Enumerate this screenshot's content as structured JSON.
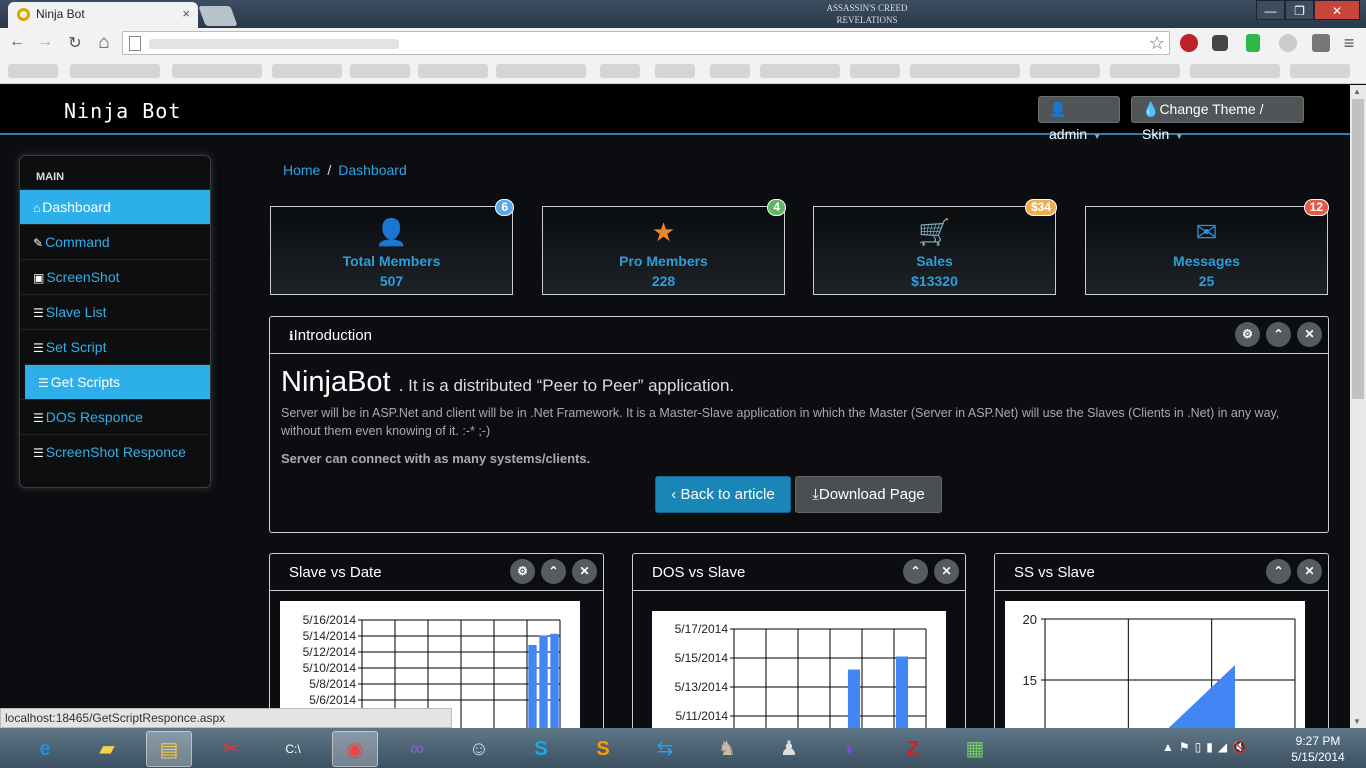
{
  "browser": {
    "tab_title": "Ninja Bot",
    "tab_close": "×",
    "window_controls": [
      "—",
      "❐",
      "✕"
    ],
    "game_logo": "ASSASSIN'S CREED REVELATIONS",
    "nav": {
      "back": "←",
      "forward": "→",
      "reload": "↻",
      "home": "⌂",
      "star": "☆",
      "menu": "≡"
    }
  },
  "app": {
    "brand": "Ninja Bot",
    "user_button": "admin",
    "theme_button": "Change Theme / Skin"
  },
  "sidebar": {
    "heading": "MAIN",
    "items": [
      {
        "label": "Dashboard",
        "icon": "home-icon"
      },
      {
        "label": "Command",
        "icon": "edit-icon"
      },
      {
        "label": "ScreenShot",
        "icon": "picture-icon"
      },
      {
        "label": "Slave List",
        "icon": "list-icon"
      },
      {
        "label": "Set Script",
        "icon": "list-icon"
      },
      {
        "label": "Get Scripts",
        "icon": "list-icon"
      },
      {
        "label": "DOS Responce",
        "icon": "list-icon"
      },
      {
        "label": "ScreenShot Responce",
        "icon": "list-icon"
      }
    ]
  },
  "breadcrumb": {
    "home": "Home",
    "sep": "/",
    "current": "Dashboard"
  },
  "stats": [
    {
      "label": "Total Members",
      "value": "507",
      "badge": "6",
      "badge_color": "#5aa9e6",
      "icon": "user-icon",
      "icon_color": "#c0342c"
    },
    {
      "label": "Pro Members",
      "value": "228",
      "badge": "4",
      "badge_color": "#5cb85c",
      "icon": "star-icon",
      "icon_color": "#f0862c"
    },
    {
      "label": "Sales",
      "value": "$13320",
      "badge": "$34",
      "badge_color": "#f0ad4e",
      "icon": "cart-icon",
      "icon_color": "#4cb648"
    },
    {
      "label": "Messages",
      "value": "25",
      "badge": "12",
      "badge_color": "#e9584a",
      "icon": "envelope-icon",
      "icon_color": "#2e8fd8"
    }
  ],
  "intro": {
    "header": "Introduction",
    "title": "NinjaBot",
    "subtitle": ". It is a distributed “Peer to Peer” application.",
    "body": "Server will be in ASP.Net and client will be in .Net Framework. It is a Master-Slave application in which the Master (Server in ASP.Net) will use the Slaves (Clients in .Net) in any way, without them even knowing of it. :-* ;-)",
    "bold": "Server can connect with as many systems/clients.",
    "back_button": "Back to article",
    "download_button": "Download Page"
  },
  "panel_buttons": {
    "settings": "⚙",
    "collapse": "⌃",
    "close": "✕"
  },
  "chart_panels": [
    {
      "title": "Slave vs Date"
    },
    {
      "title": "DOS vs Slave"
    },
    {
      "title": "SS vs Slave"
    }
  ],
  "chart_data": [
    {
      "type": "bar",
      "title": "Slave vs Date",
      "y_ticks": [
        "5/16/2014",
        "5/14/2014",
        "5/12/2014",
        "5/10/2014",
        "5/8/2014",
        "5/6/2014"
      ],
      "values": [
        0,
        0,
        0,
        0,
        0,
        0,
        0,
        0,
        0,
        0,
        0,
        0,
        0.05,
        0.05,
        0.06,
        0.6,
        0.66,
        0.67
      ]
    },
    {
      "type": "bar",
      "title": "DOS vs Slave",
      "y_ticks": [
        "5/17/2014",
        "5/15/2014",
        "5/13/2014",
        "5/11/2014"
      ],
      "values": [
        0,
        0,
        0,
        0,
        0,
        0,
        0,
        0.55,
        0,
        0,
        0.65,
        0
      ]
    },
    {
      "type": "area",
      "title": "SS vs Slave",
      "y_ticks": [
        "20",
        "15"
      ],
      "ylim": [
        10,
        20
      ],
      "series_fill": "#4285f4"
    }
  ],
  "status_url": "localhost:18465/GetScriptResponce.aspx",
  "taskbar": {
    "time": "9:27 PM",
    "date": "5/15/2014"
  },
  "colors": {
    "accent": "#2db0ea",
    "header_bg": "#000000",
    "bar_blue": "#4285f4"
  }
}
